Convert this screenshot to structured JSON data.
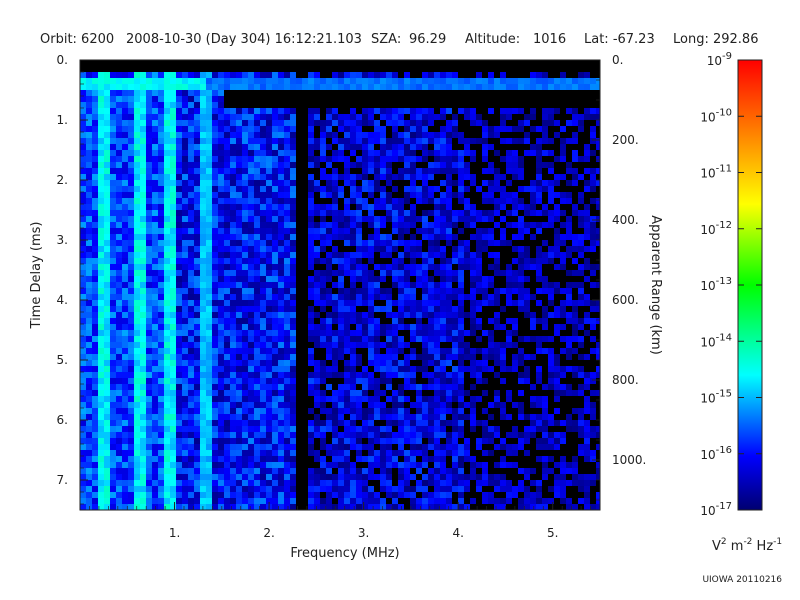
{
  "header": {
    "orbit": "Orbit: 6200",
    "datetime": "2008-10-30 (Day 304) 16:12:21.103",
    "sza_label": "SZA:",
    "sza_value": "96.29",
    "altitude_label": "Altitude:",
    "altitude_value": "1016",
    "lat": "Lat: -67.23",
    "long": "Long: 292.86"
  },
  "chart_data": {
    "type": "heatmap",
    "title": "",
    "xlabel": "Frequency (MHz)",
    "ylabel": "Time Delay (ms)",
    "y2label": "Apparent Range (km)",
    "xlim": [
      0.0,
      5.5
    ],
    "ylim": [
      0.0,
      7.5
    ],
    "y_reversed": true,
    "y2lim": [
      0,
      1125
    ],
    "x_ticks": [
      1,
      2,
      3,
      4,
      5
    ],
    "x_tick_labels": [
      "1.",
      "2.",
      "3.",
      "4.",
      "5."
    ],
    "y_ticks": [
      0,
      1,
      2,
      3,
      4,
      5,
      6,
      7
    ],
    "y_tick_labels": [
      "0.",
      "1.",
      "2.",
      "3.",
      "4.",
      "5.",
      "6.",
      "7."
    ],
    "y2_ticks": [
      0,
      200,
      400,
      600,
      800,
      1000
    ],
    "y2_tick_labels": [
      "0.",
      "200.",
      "400.",
      "600.",
      "800.",
      "1000."
    ],
    "colorbar": {
      "scale": "log",
      "min": 1e-17,
      "max": 1e-09,
      "tick_labels": [
        {
          "base": "10",
          "exp": "-9"
        },
        {
          "base": "10",
          "exp": "-10"
        },
        {
          "base": "10",
          "exp": "-11"
        },
        {
          "base": "10",
          "exp": "-12"
        },
        {
          "base": "10",
          "exp": "-13"
        },
        {
          "base": "10",
          "exp": "-14"
        },
        {
          "base": "10",
          "exp": "-15"
        },
        {
          "base": "10",
          "exp": "-16"
        },
        {
          "base": "10",
          "exp": "-17"
        }
      ],
      "unit_parts": [
        "V",
        "2",
        " m",
        "-2",
        " Hz",
        "-1"
      ]
    },
    "features": [
      {
        "description": "strong low-frequency vertical streaks",
        "x_range": [
          0.0,
          1.0
        ],
        "level_log10": -14.5
      },
      {
        "description": "bright column near 1.3 MHz",
        "x": 1.3,
        "level_log10": -15
      },
      {
        "description": "dark vertical gap near 2.35 MHz",
        "x": 2.35,
        "level_log10": -17
      },
      {
        "description": "horizontal band at ~0.3 ms",
        "y": 0.3,
        "level_log10": -15
      }
    ],
    "grid": false,
    "legend": "colorbar-right"
  },
  "footer": {
    "credit": "UIOWA 20110216"
  },
  "colors": {
    "background_plot": "#000000",
    "low": "#0000a0",
    "mid": "#00c8ff",
    "high": "#00ff60",
    "text": "#222222"
  }
}
